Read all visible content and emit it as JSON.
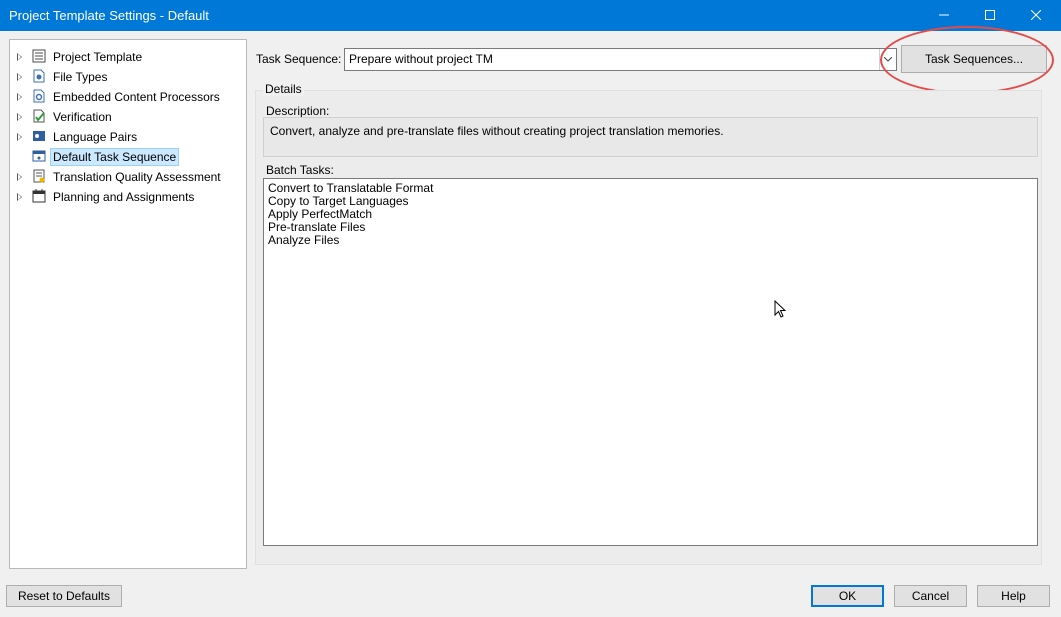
{
  "window": {
    "title": "Project Template Settings - Default",
    "controls": [
      "minimize-icon",
      "maximize-icon",
      "close-icon"
    ]
  },
  "tree": {
    "items": [
      {
        "label": "Project Template",
        "icon": "project-template-icon",
        "expandable": true
      },
      {
        "label": "File Types",
        "icon": "file-types-icon",
        "expandable": true
      },
      {
        "label": "Embedded Content Processors",
        "icon": "embedded-content-icon",
        "expandable": true
      },
      {
        "label": "Verification",
        "icon": "verification-icon",
        "expandable": true
      },
      {
        "label": "Language Pairs",
        "icon": "language-pairs-icon",
        "expandable": true
      },
      {
        "label": "Default Task Sequence",
        "icon": "task-sequence-icon",
        "expandable": false,
        "selected": true
      },
      {
        "label": "Translation Quality Assessment",
        "icon": "quality-assessment-icon",
        "expandable": true
      },
      {
        "label": "Planning and Assignments",
        "icon": "calendar-icon",
        "expandable": true
      }
    ]
  },
  "task_sequence": {
    "label": "Task Sequence:",
    "value": "Prepare without project TM",
    "button_label": "Task Sequences..."
  },
  "details": {
    "group_label": "Details",
    "description_label": "Description:",
    "description": "Convert, analyze and pre-translate files without creating project translation memories.",
    "batch_tasks_label": "Batch Tasks:",
    "batch_tasks": [
      "Convert to Translatable Format",
      "Copy to Target Languages",
      "Apply PerfectMatch",
      "Pre-translate Files",
      "Analyze Files"
    ]
  },
  "footer": {
    "reset_label": "Reset to Defaults",
    "ok_label": "OK",
    "cancel_label": "Cancel",
    "help_label": "Help"
  },
  "colors": {
    "titlebar": "#0078d7",
    "selection": "#cce8ff",
    "highlight_ellipse": "#e34a4a"
  }
}
